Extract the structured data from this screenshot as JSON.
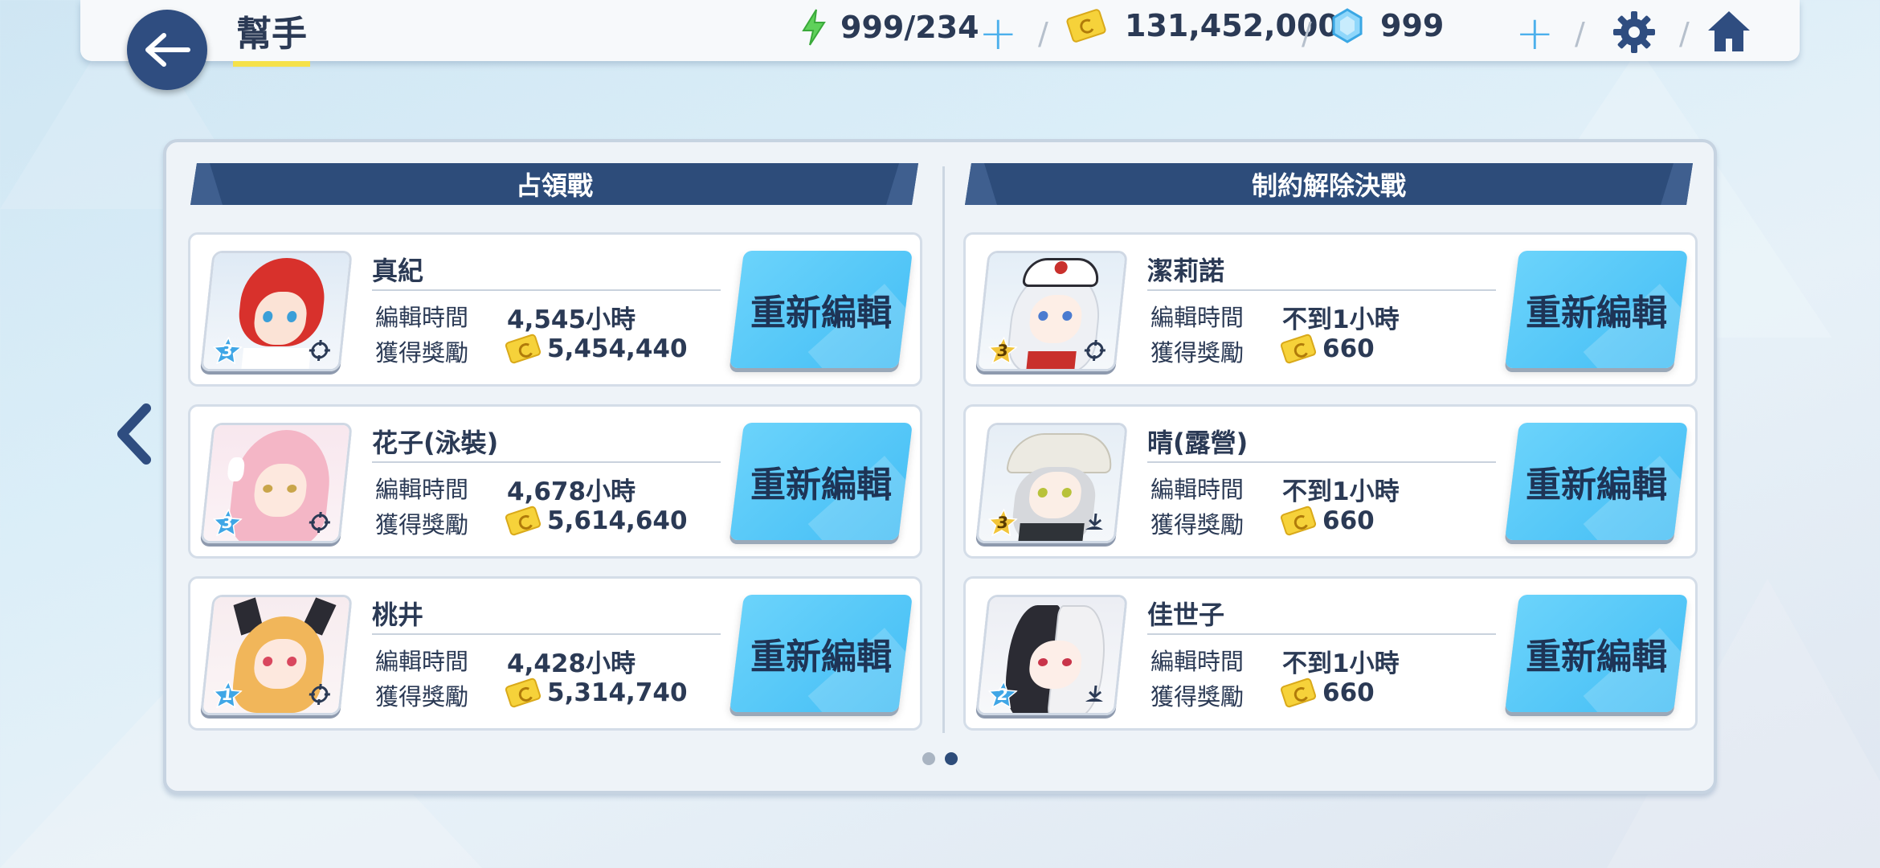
{
  "header": {
    "title": "幫手",
    "stamina": "999/234",
    "credits": "131,452,000",
    "gems": "999"
  },
  "columns": [
    {
      "title": "占領戰",
      "cards": [
        {
          "name": "真紀",
          "star": "3",
          "time_label": "編輯時間",
          "time_value": "4,545小時",
          "reward_label": "獲得獎勵",
          "reward_value": "5,454,440",
          "button": "重新編輯"
        },
        {
          "name": "花子(泳裝)",
          "star": "3",
          "time_label": "編輯時間",
          "time_value": "4,678小時",
          "reward_label": "獲得獎勵",
          "reward_value": "5,614,640",
          "button": "重新編輯"
        },
        {
          "name": "桃井",
          "star": "1",
          "time_label": "編輯時間",
          "time_value": "4,428小時",
          "reward_label": "獲得獎勵",
          "reward_value": "5,314,740",
          "button": "重新編輯"
        }
      ]
    },
    {
      "title": "制約解除決戰",
      "cards": [
        {
          "name": "潔莉諾",
          "star": "3",
          "time_label": "編輯時間",
          "time_value": "不到1小時",
          "reward_label": "獲得獎勵",
          "reward_value": "660",
          "button": "重新編輯"
        },
        {
          "name": "晴(露營)",
          "star": "3",
          "time_label": "編輯時間",
          "time_value": "不到1小時",
          "reward_label": "獲得獎勵",
          "reward_value": "660",
          "button": "重新編輯"
        },
        {
          "name": "佳世子",
          "star": "2",
          "time_label": "編輯時間",
          "time_value": "不到1小時",
          "reward_label": "獲得獎勵",
          "reward_value": "660",
          "button": "重新編輯"
        }
      ]
    }
  ],
  "pagination": {
    "current_page": 2,
    "total_pages": 2
  },
  "colors": {
    "accent_dark": "#2d4c7a",
    "button": "#4cbff5",
    "gold_star": "#f2c53a",
    "blue_star": "#3fa6e6"
  }
}
